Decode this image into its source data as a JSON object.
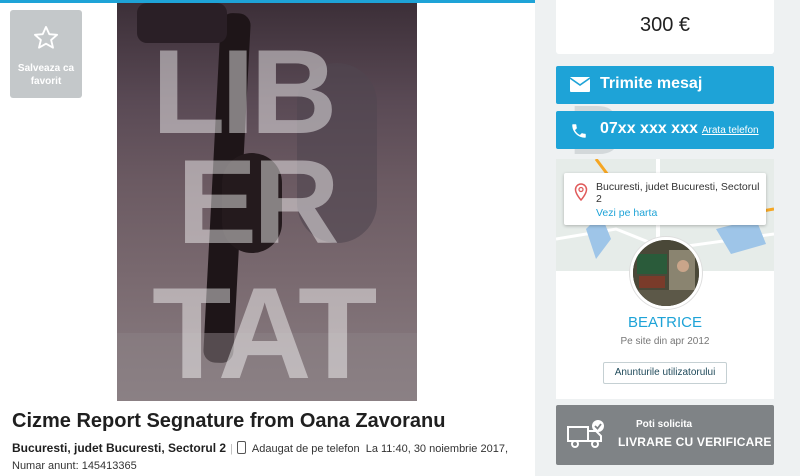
{
  "favorite": {
    "label": "Salveaza ca favorit",
    "icon": "star-icon"
  },
  "photo": {
    "watermark": "LIBERTATEA"
  },
  "listing": {
    "title": "Cizme Report Segnature from Oana Zavoranu",
    "location": "Bucuresti, judet Bucuresti, Sectorul 2",
    "added_via": "Adaugat de pe telefon",
    "added_at": "La 11:40, 30 noiembrie 2017,",
    "ad_number": "Numar anunt: 145413365"
  },
  "sidebar": {
    "price": "300 €",
    "message_button": "Trimite mesaj",
    "phone_masked": "07xx xxx xxx",
    "show_phone": "Arata telefon",
    "map": {
      "address": "Bucuresti, judet Bucuresti, Sectorul 2",
      "view_on_map": "Vezi pe harta"
    },
    "user": {
      "name": "BEATRICE",
      "since": "Pe site din apr 2012",
      "ads_button": "Anunturile utilizatorului"
    },
    "delivery": {
      "line1": "Poti solicita",
      "line2": "LIVRARE CU VERIFICARE"
    }
  },
  "colors": {
    "accent": "#1ea3d7",
    "dark_text": "#002f34",
    "delivery_bg": "#7f8386"
  }
}
